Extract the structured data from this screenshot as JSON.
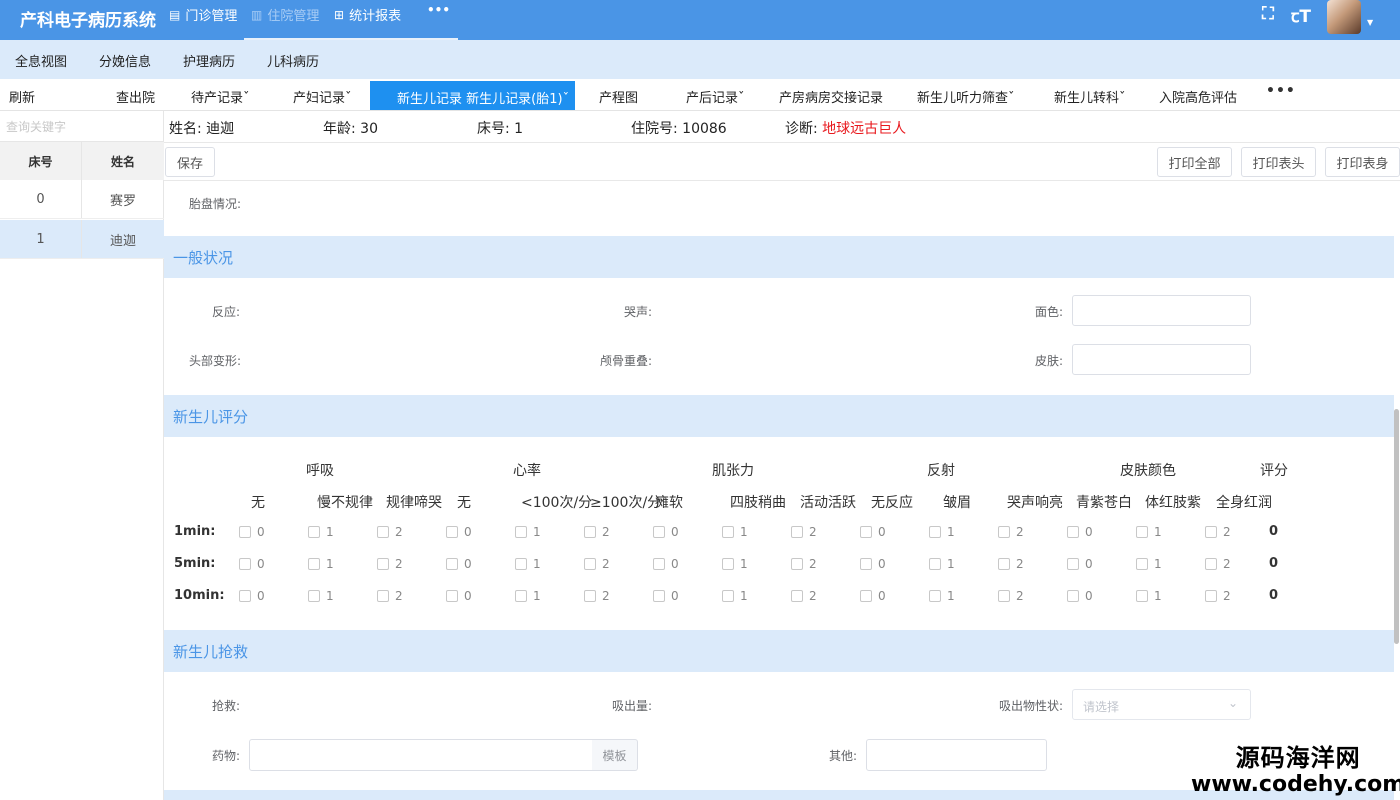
{
  "app": {
    "title": "产科电子病历系统"
  },
  "nav": {
    "items": [
      {
        "label": "门诊管理",
        "icon": "document-icon"
      },
      {
        "label": "住院管理",
        "icon": "chart-icon"
      },
      {
        "label": "统计报表",
        "icon": "grid-icon"
      }
    ],
    "more": "•••",
    "active_index": 1
  },
  "menu": {
    "items": [
      "全息视图",
      "分娩信息",
      "护理病历",
      "儿科病历"
    ]
  },
  "tabs": {
    "items": [
      "刷新",
      "查出院",
      "待产记录",
      "产妇记录",
      "新生儿记录 新生儿记录(胎1)",
      "产程图",
      "产后记录",
      "产房病房交接记录",
      "新生儿听力筛查",
      "新生儿转科",
      "入院高危评估"
    ],
    "active": "新生儿记录 新生儿记录(胎1)",
    "more": "•••"
  },
  "sidebar": {
    "search_placeholder": "查询关键字",
    "headers": [
      "床号",
      "姓名"
    ],
    "rows": [
      {
        "bed": "0",
        "name": "赛罗"
      },
      {
        "bed": "1",
        "name": "迪迦"
      }
    ],
    "selected_index": 1
  },
  "patient": {
    "name_label": "姓名:",
    "name": "迪迦",
    "age_label": "年龄:",
    "age": "30",
    "bed_label": "床号:",
    "bed": "1",
    "admission_label": "住院号:",
    "admission": "10086",
    "diagnosis_label": "诊断:",
    "diagnosis": "地球远古巨人"
  },
  "toolbar": {
    "save": "保存",
    "print_all": "打印全部",
    "print_header": "打印表头",
    "print_body": "打印表身"
  },
  "placenta": {
    "label": "胎盘情况:"
  },
  "general": {
    "title": "一般状况",
    "reaction": "反应:",
    "cry": "哭声:",
    "face_color": "面色:",
    "head_deform": "头部变形:",
    "skull_overlap": "颅骨重叠:",
    "skin": "皮肤:"
  },
  "score": {
    "title": "新生儿评分",
    "groups": [
      "呼吸",
      "心率",
      "肌张力",
      "反射",
      "皮肤颜色",
      "评分"
    ],
    "subs": [
      "无",
      "慢不规律",
      "规律啼哭",
      "无",
      "<100次/分",
      "≥100次/分",
      "瘫软",
      "四肢稍曲",
      "活动活跃",
      "无反应",
      "皱眉",
      "哭声响亮",
      "青紫苍白",
      "体红肢紫",
      "全身红润"
    ],
    "values": [
      "0",
      "1",
      "2",
      "0",
      "1",
      "2",
      "0",
      "1",
      "2",
      "0",
      "1",
      "2",
      "0",
      "1",
      "2"
    ],
    "rows": [
      {
        "label": "1min:",
        "total": "0"
      },
      {
        "label": "5min:",
        "total": "0"
      },
      {
        "label": "10min:",
        "total": "0"
      }
    ]
  },
  "rescue": {
    "title": "新生儿抢救",
    "rescue": "抢救:",
    "suction": "吸出量:",
    "suction_nature": "吸出物性状:",
    "select_placeholder": "请选择",
    "drug": "药物:",
    "template": "模板",
    "other": "其他:"
  },
  "watermark": {
    "line1": "源码海洋网",
    "line2": "www.codehy.com"
  }
}
